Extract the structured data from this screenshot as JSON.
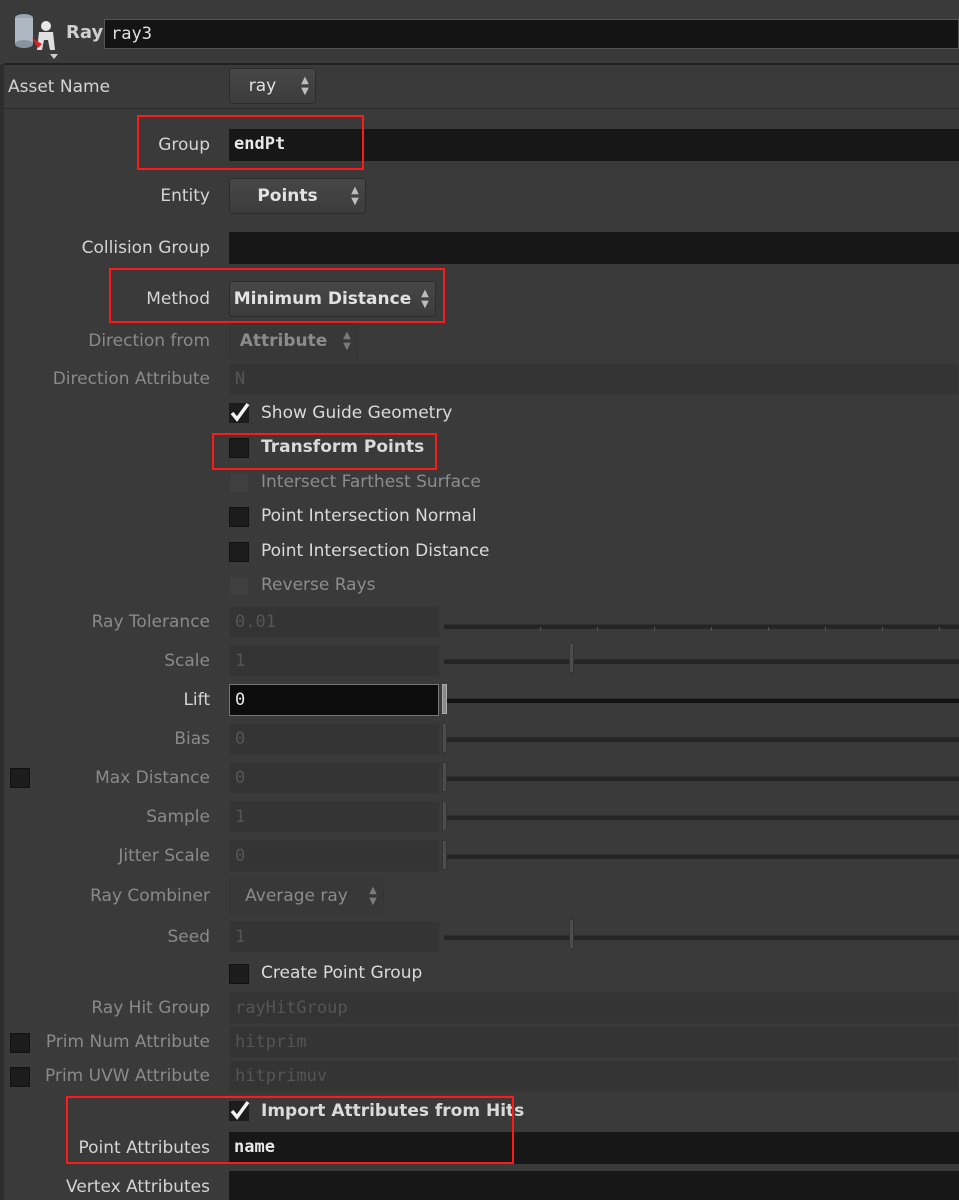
{
  "header": {
    "node_type": "Ray",
    "node_name": "ray3"
  },
  "params": {
    "asset_name": {
      "label": "Asset Name",
      "value": "ray"
    },
    "group": {
      "label": "Group",
      "value": "endPt"
    },
    "entity": {
      "label": "Entity",
      "value": "Points"
    },
    "collision_group": {
      "label": "Collision Group",
      "value": ""
    },
    "method": {
      "label": "Method",
      "value": "Minimum Distance"
    },
    "direction_from": {
      "label": "Direction from",
      "value": "Attribute"
    },
    "direction_attribute": {
      "label": "Direction Attribute",
      "value": "N"
    },
    "show_guide_geometry": {
      "label": "Show Guide Geometry",
      "checked": true
    },
    "transform_points": {
      "label": "Transform Points",
      "checked": false
    },
    "intersect_farthest_surface": {
      "label": "Intersect Farthest Surface",
      "checked": false
    },
    "point_intersection_normal": {
      "label": "Point Intersection Normal",
      "checked": false
    },
    "point_intersection_distance": {
      "label": "Point Intersection Distance",
      "checked": false
    },
    "reverse_rays": {
      "label": "Reverse Rays",
      "checked": false
    },
    "ray_tolerance": {
      "label": "Ray Tolerance",
      "value": "0.01"
    },
    "scale": {
      "label": "Scale",
      "value": "1"
    },
    "lift": {
      "label": "Lift",
      "value": "0"
    },
    "bias": {
      "label": "Bias",
      "value": "0"
    },
    "max_distance": {
      "label": "Max Distance",
      "value": "0",
      "enabled": false
    },
    "sample": {
      "label": "Sample",
      "value": "1"
    },
    "jitter_scale": {
      "label": "Jitter Scale",
      "value": "0"
    },
    "ray_combiner": {
      "label": "Ray Combiner",
      "value": "Average ray"
    },
    "seed": {
      "label": "Seed",
      "value": "1"
    },
    "create_point_group": {
      "label": "Create Point Group",
      "checked": false
    },
    "ray_hit_group": {
      "label": "Ray Hit Group",
      "value": "rayHitGroup"
    },
    "prim_num_attribute": {
      "label": "Prim Num Attribute",
      "value": "hitprim",
      "enabled": false
    },
    "prim_uvw_attribute": {
      "label": "Prim UVW Attribute",
      "value": "hitprimuv",
      "enabled": false
    },
    "import_attributes_from_hits": {
      "label": "Import Attributes from Hits",
      "checked": true
    },
    "point_attributes": {
      "label": "Point Attributes",
      "value": "name"
    },
    "vertex_attributes": {
      "label": "Vertex Attributes",
      "value": ""
    }
  },
  "colors": {
    "highlight": "#ff1a1a",
    "background": "#3a3a3a",
    "field": "#171717"
  }
}
